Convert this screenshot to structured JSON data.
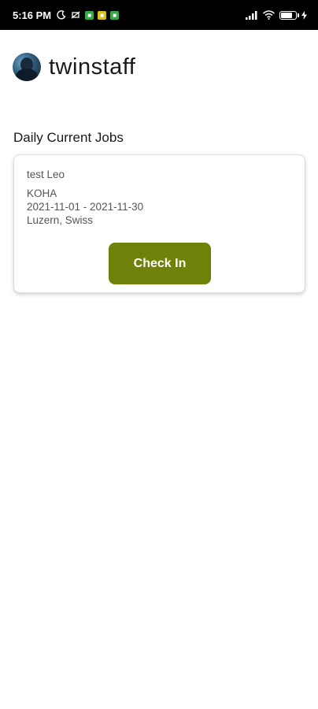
{
  "status_bar": {
    "time": "5:16 PM",
    "battery_level": 0.8,
    "icons": [
      "moon-icon",
      "hotspot-icon",
      "notification-app-icon",
      "notification-app-icon",
      "notification-app-icon",
      "signal-icon",
      "wifi-icon",
      "battery-icon",
      "charging-icon"
    ],
    "notification_colors": [
      "#3aa84a",
      "#d6c21d",
      "#3aa84a"
    ]
  },
  "header": {
    "app_title": "twinstaff"
  },
  "section": {
    "title": "Daily Current Jobs"
  },
  "job": {
    "name": "test Leo",
    "company": "KOHA",
    "date_range": "2021-11-01 - 2021-11-30",
    "location": "Luzern, Swiss",
    "button_label": "Check In"
  },
  "colors": {
    "accent": "#6f8108",
    "status_bar_bg": "#000000"
  }
}
